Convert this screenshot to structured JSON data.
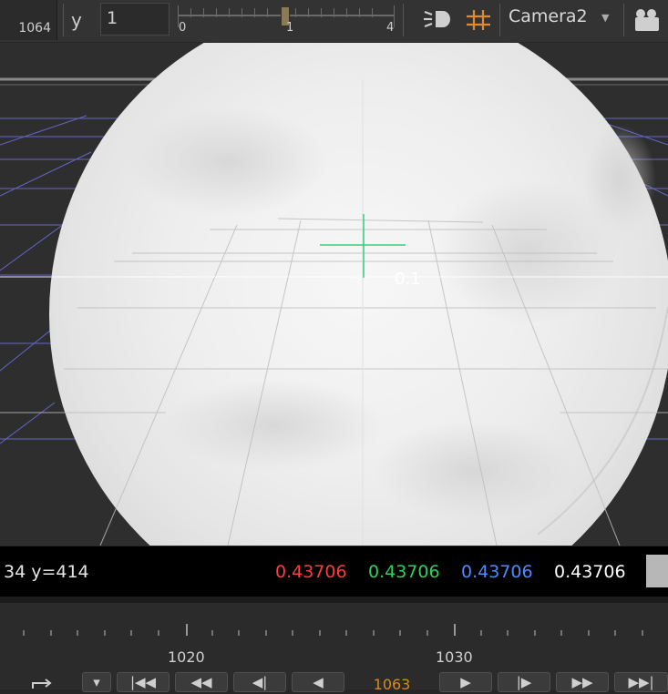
{
  "toolbar": {
    "frame_value": "1064",
    "gamma_label": "y",
    "gamma_value": "1",
    "slider": {
      "min_label": "0",
      "mid_label": "1",
      "max_label": "4",
      "level": 1
    },
    "camera_value": "Camera2",
    "icons": [
      "light-icon",
      "grid-icon",
      "camera-icon"
    ],
    "grid_icon_color": "#e08a2e"
  },
  "viewport": {
    "overlay_label": "0.1",
    "grid_color": "#6b6bd8",
    "crosshair_color": "#33d17a"
  },
  "status": {
    "coords": "34 y=414",
    "r": "0.43706",
    "g": "0.43706",
    "b": "0.43706",
    "a": "0.43706",
    "colors": {
      "r": "#ff3b3b",
      "g": "#2ed15a",
      "b": "#4a8cff",
      "a": "#ffffff"
    }
  },
  "timeline": {
    "labels": [
      "1020",
      "1030"
    ]
  },
  "controls": {
    "frame_display": "1063"
  }
}
